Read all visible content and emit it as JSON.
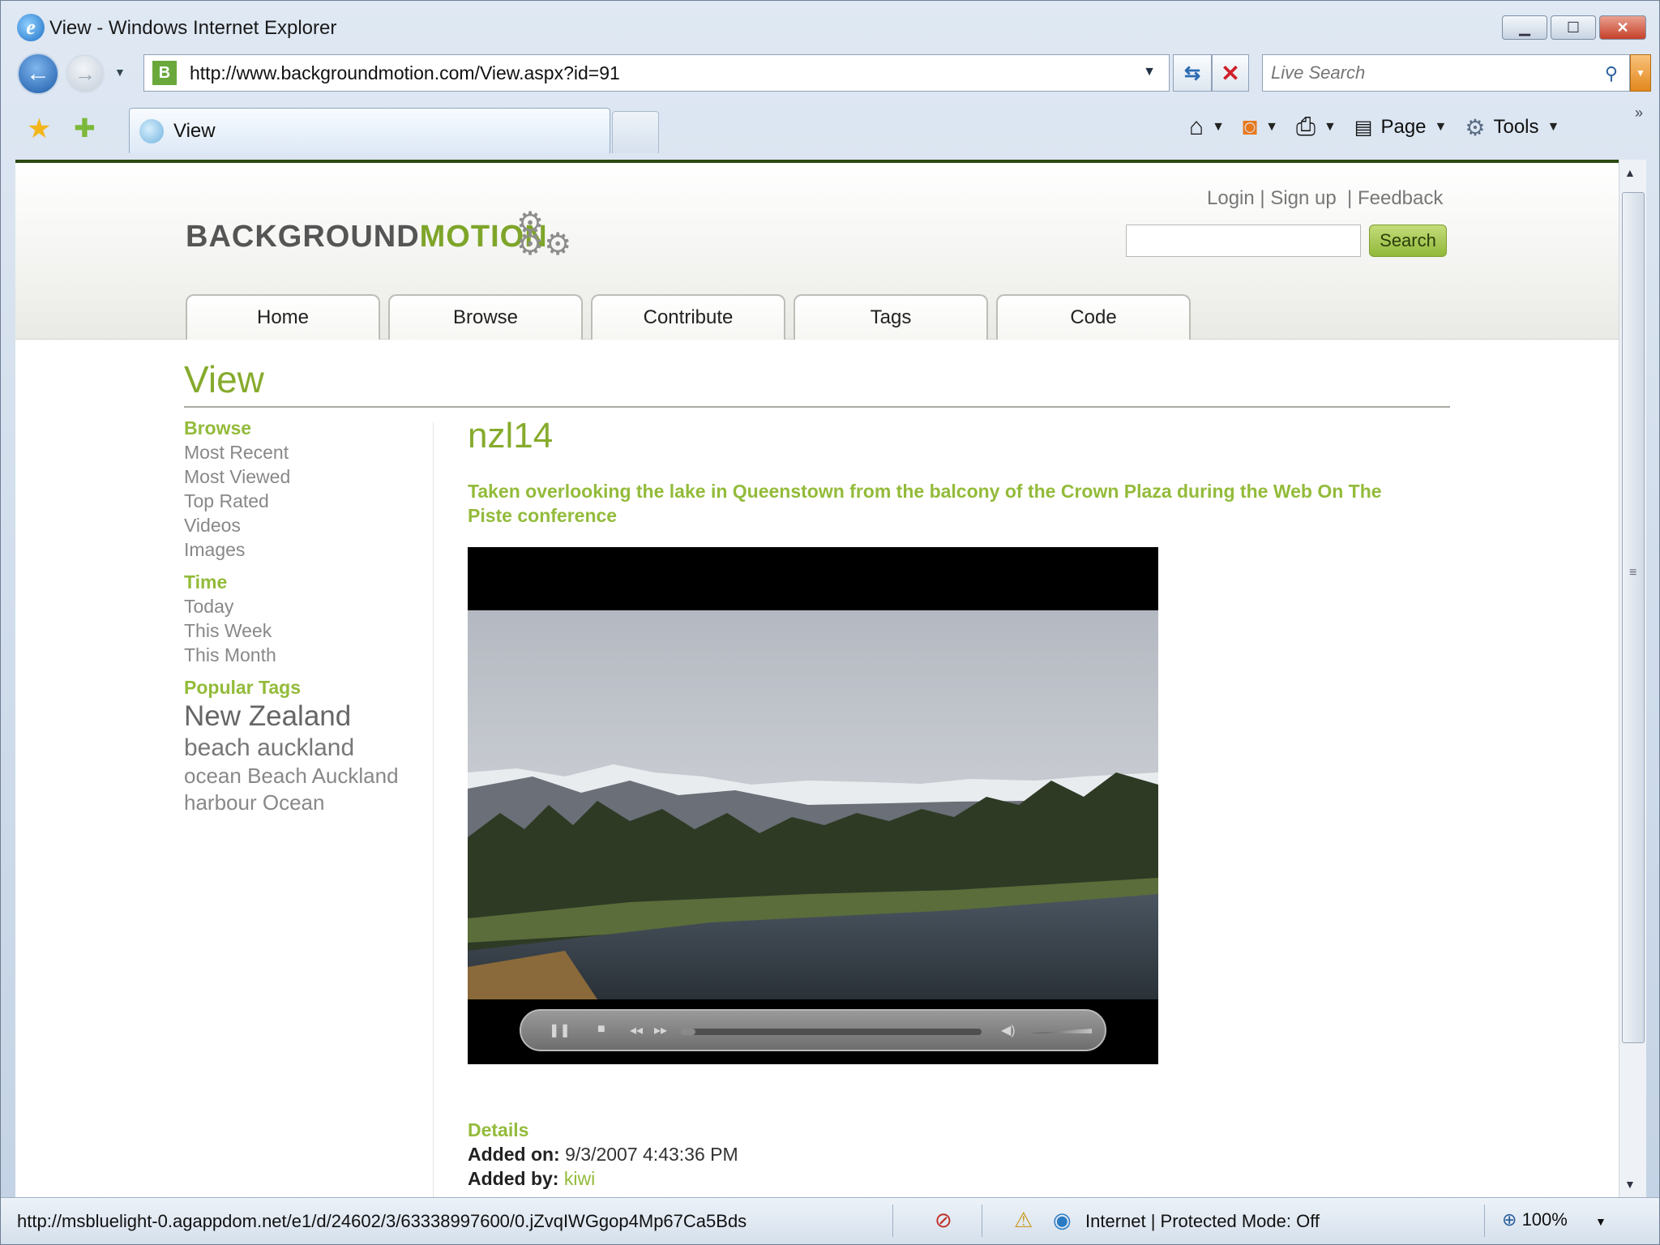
{
  "window": {
    "title": "View - Windows Internet Explorer"
  },
  "browser": {
    "url": "http://www.backgroundmotion.com/View.aspx?id=91",
    "live_search_placeholder": "Live Search",
    "tab_label": "View",
    "commands": {
      "page": "Page",
      "tools": "Tools"
    }
  },
  "site": {
    "logo_part1": "BACKGROUND",
    "logo_part2": "MOTION",
    "top_links": {
      "login": "Login",
      "signup": "Sign up",
      "feedback": "Feedback"
    },
    "search_button": "Search",
    "nav": [
      "Home",
      "Browse",
      "Contribute",
      "Tags",
      "Code"
    ],
    "accent_color": "#86ab2d"
  },
  "page": {
    "title": "View",
    "sidebar": {
      "browse_heading": "Browse",
      "browse_links": [
        "Most Recent",
        "Most Viewed",
        "Top Rated",
        "Videos",
        "Images"
      ],
      "time_heading": "Time",
      "time_links": [
        "Today",
        "This Week",
        "This Month"
      ],
      "tags_heading": "Popular Tags",
      "tags": [
        "New Zealand",
        "beach auckland",
        "ocean Beach Auckland",
        "harbour Ocean"
      ]
    },
    "video": {
      "title": "nzl14",
      "description": "Taken overlooking the lake in Queenstown from the balcony of the Crown Plaza during the Web On The Piste conference",
      "progress": 0.05
    },
    "details": {
      "heading": "Details",
      "added_on_label": "Added on:",
      "added_on_value": "9/3/2007 4:43:36 PM",
      "added_by_label": "Added by:",
      "added_by_value": "kiwi"
    }
  },
  "status": {
    "url": "http://msbluelight-0.agappdom.net/e1/d/24602/3/63338997600/0.jZvqIWGgop4Mp67Ca5Bds",
    "zone": "Internet | Protected Mode: Off",
    "zoom": "100%"
  }
}
